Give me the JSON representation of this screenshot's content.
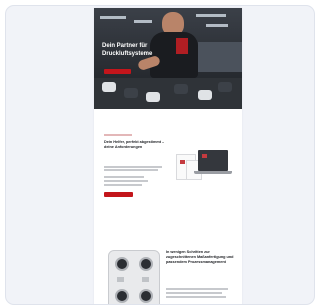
{
  "hero": {
    "title": "Dein Partner für Druckluftsysteme",
    "cta_label": ""
  },
  "section_intro": {
    "title": "Dein Helfer, perfekt abgestimmt – deine Anforderungen",
    "cta_label": ""
  },
  "section_steps": {
    "title": "In wenigen Schritten zur zugeschnittenen Maßanfertigung und passendem Prozessmanagement"
  },
  "colors": {
    "accent": "#c3151b",
    "card_background": "#f1f3f8",
    "hero_dark": "#2a2e34"
  }
}
